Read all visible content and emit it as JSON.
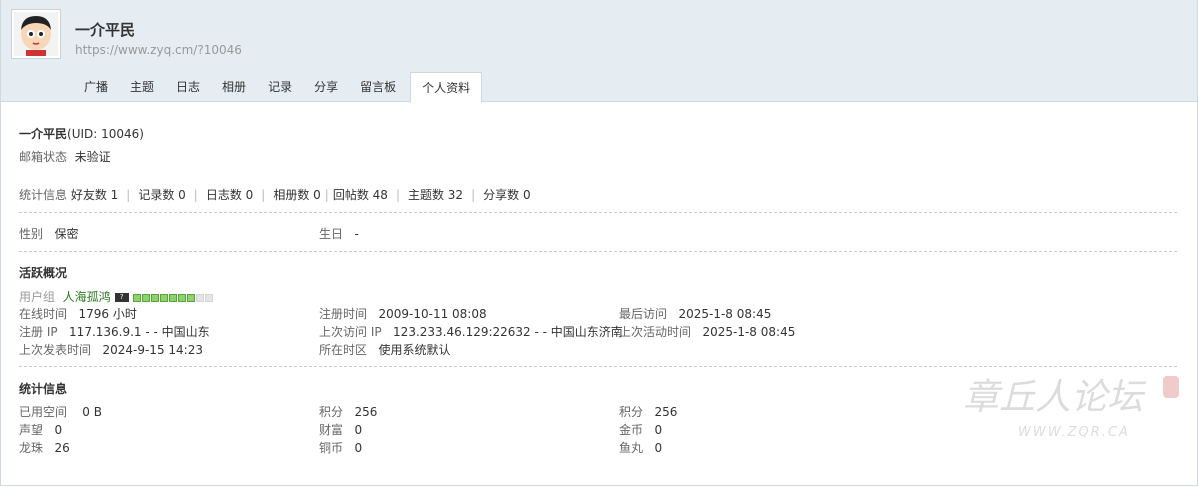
{
  "user": {
    "name": "一介平民",
    "url": "https://www.zyq.cm/?10046"
  },
  "tabs": [
    {
      "label": "广播"
    },
    {
      "label": "主题"
    },
    {
      "label": "日志"
    },
    {
      "label": "相册"
    },
    {
      "label": "记录"
    },
    {
      "label": "分享"
    },
    {
      "label": "留言板"
    },
    {
      "label": "个人资料"
    }
  ],
  "profile": {
    "name_uid": "一介平民",
    "uid_text": "(UID: 10046)",
    "email_label": "邮箱状态",
    "email_value": "未验证",
    "stats_label": "统计信息",
    "stats": [
      {
        "label": "好友数 1"
      },
      {
        "label": "记录数 0"
      },
      {
        "label": "日志数 0"
      },
      {
        "label": "相册数 0"
      },
      {
        "label": "回帖数 48"
      },
      {
        "label": "主题数 32"
      },
      {
        "label": "分享数 0"
      }
    ],
    "gender_label": "性别",
    "gender_value": "保密",
    "birthday_label": "生日",
    "birthday_value": "-"
  },
  "activity": {
    "title": "活跃概况",
    "usergroup_label": "用户组",
    "usergroup_value": "人海孤鸿",
    "badge_text": "?",
    "level_filled": 7,
    "level_total": 9,
    "online_label": "在线时间",
    "online_value": "1796 小时",
    "reg_time_label": "注册时间",
    "reg_time_value": "2009-10-11 08:08",
    "last_visit_label": "最后访问",
    "last_visit_value": "2025-1-8 08:45",
    "reg_ip_label": "注册 IP",
    "reg_ip_value": "117.136.9.1 - - 中国山东",
    "last_ip_label": "上次访问 IP",
    "last_ip_value": "123.233.46.129:22632 - - 中国山东济南",
    "last_active_label": "上次活动时间",
    "last_active_value": "2025-1-8 08:45",
    "last_post_label": "上次发表时间",
    "last_post_value": "2024-9-15 14:23",
    "timezone_label": "所在时区",
    "timezone_value": "使用系统默认"
  },
  "statistics": {
    "title": "统计信息",
    "rows": [
      [
        {
          "label": "已用空间",
          "value": "0 B"
        },
        {
          "label": "积分",
          "value": "256"
        },
        {
          "label": "积分",
          "value": "256"
        }
      ],
      [
        {
          "label": "声望",
          "value": "0"
        },
        {
          "label": "财富",
          "value": "0"
        },
        {
          "label": "金币",
          "value": "0"
        }
      ],
      [
        {
          "label": "龙珠",
          "value": "26"
        },
        {
          "label": "铜币",
          "value": "0"
        },
        {
          "label": "鱼丸",
          "value": "0"
        }
      ]
    ]
  },
  "watermark": {
    "text": "章丘人论坛",
    "url": "WWW.ZQR.CA"
  },
  "colors": {
    "header_bg": "#e5edf2",
    "border": "#cdd9e3",
    "level_bar": "#8bd36b",
    "group_name": "#2a7a1f"
  }
}
